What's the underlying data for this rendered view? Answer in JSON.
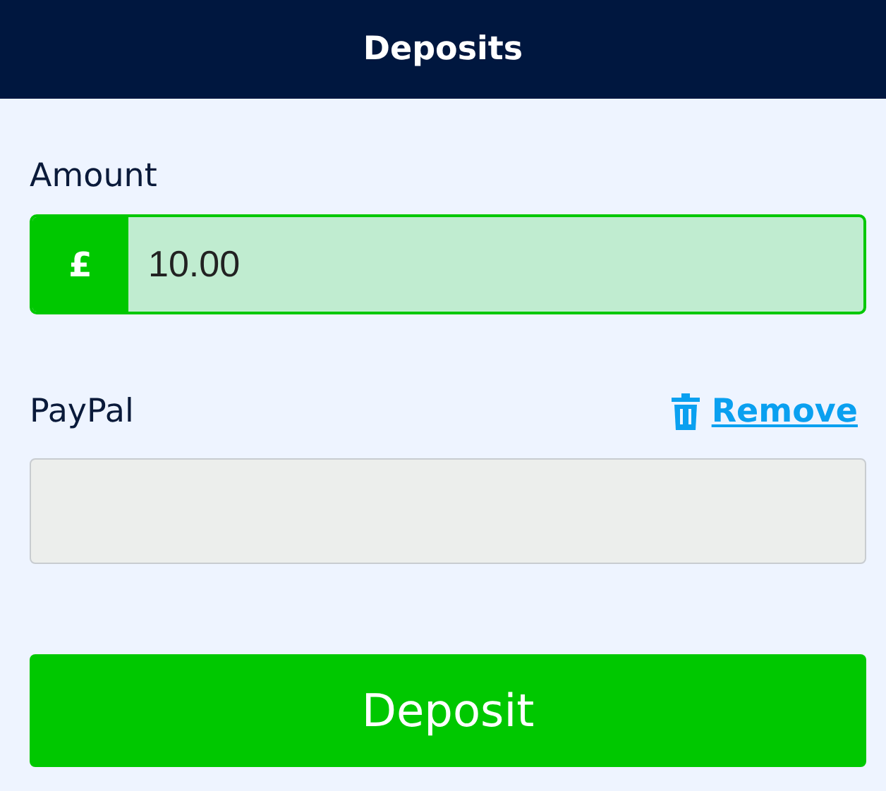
{
  "header": {
    "title": "Deposits"
  },
  "amount": {
    "label": "Amount",
    "currency": "£",
    "value": "10.00"
  },
  "paypal": {
    "label": "PayPal",
    "remove": "Remove"
  },
  "button": {
    "label": "Deposit"
  }
}
